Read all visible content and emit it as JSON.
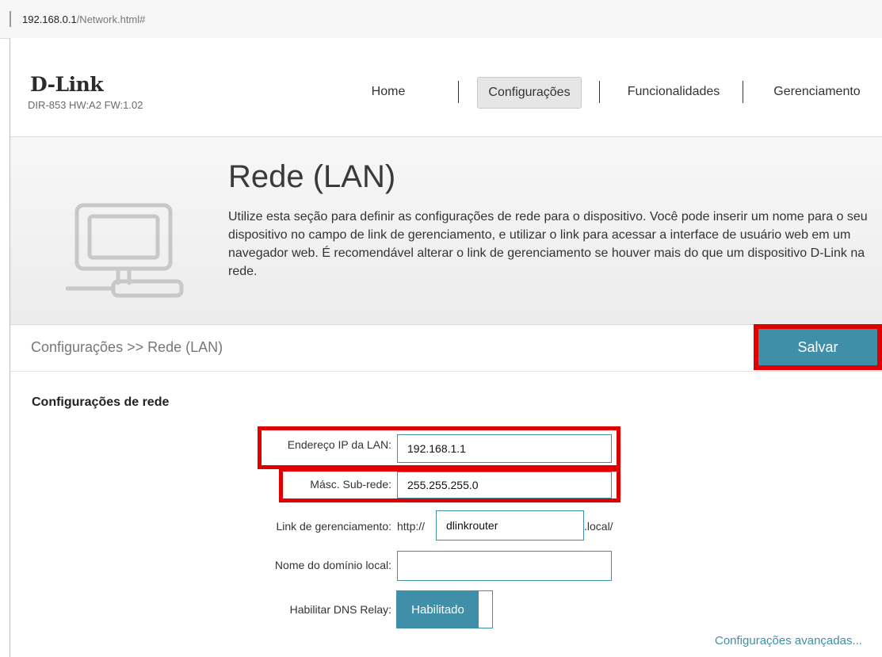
{
  "browser": {
    "address_host": "192.168.0.1",
    "address_path": "/Network.html#"
  },
  "header": {
    "logo": "D-Link",
    "model": "DIR-853 HW:A2 FW:1.02",
    "nav": [
      {
        "label": "Home"
      },
      {
        "label": "Configurações",
        "active": true
      },
      {
        "label": "Funcionalidades"
      },
      {
        "label": "Gerenciamento"
      }
    ]
  },
  "banner": {
    "icon": "computer-network-icon",
    "title": "Rede (LAN)",
    "description": "Utilize esta seção para definir as configurações de rede para o dispositivo. Você pode inserir um nome para o seu dispositivo no campo de link de gerenciamento, e utilizar o link para acessar a interface de usuário web em um navegador web. É recomendável alterar o link de gerenciamento se houver mais do que um dispositivo D-Link na rede."
  },
  "breadcrumb": "Configurações >> Rede (LAN)",
  "save_label": "Salvar",
  "form": {
    "section_title": "Configurações de rede",
    "lan_ip": {
      "label": "Endereço IP da LAN:",
      "value": "192.168.1.1"
    },
    "subnet": {
      "label": "Másc. Sub-rede:",
      "value": "255.255.255.0"
    },
    "mgmt_link": {
      "label": "Link de gerenciamento:",
      "prefix": "http://",
      "value": "dlinkrouter",
      "suffix": ".local/"
    },
    "domain": {
      "label": "Nome do domínio local:",
      "value": ""
    },
    "dns_relay": {
      "label": "Habilitar DNS Relay:",
      "state": "Habilitado"
    },
    "advanced_link": "Configurações avançadas..."
  },
  "colors": {
    "accent": "#3f8fa8",
    "highlight": "#e00000"
  }
}
